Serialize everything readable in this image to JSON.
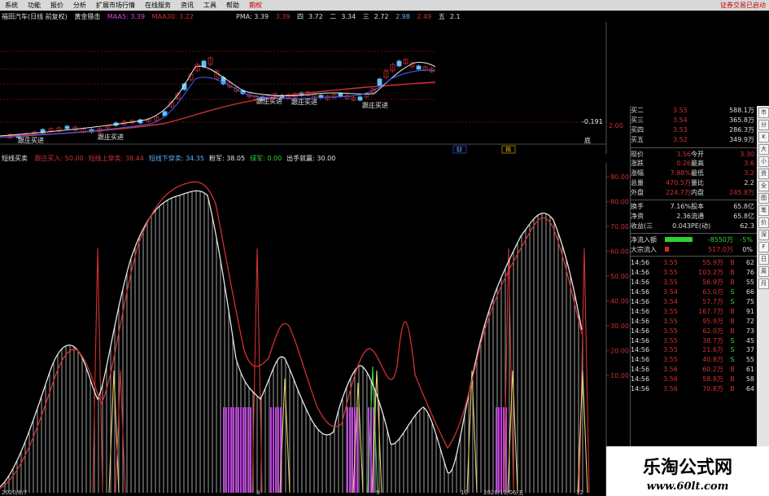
{
  "menubar": {
    "items": [
      "系统",
      "功能",
      "报价",
      "分析",
      "扩展市场行情",
      "在线服务",
      "资讯",
      "工具",
      "帮助",
      "期权"
    ],
    "right_text": "证券交易已启动"
  },
  "upper_info": {
    "stock_title": "福田汽车(日线 前复权)",
    "indicator_name": "黄金猎击",
    "ma5_label": "MAA5: 3.39",
    "ma5_value": "3.39",
    "ma30_label": "MAA30: 3.22",
    "pma_label": "PMA: 3.39",
    "pma_value": "3.39",
    "col2": "3.72",
    "col2_prefix": "四",
    "col3": "3.34",
    "col3_prefix": "二",
    "col4": "2.72",
    "col4_prefix": "三",
    "col5": "2.98",
    "col6": "2.49",
    "col7": "2.1",
    "col7_prefix": "五"
  },
  "upper_chart": {
    "labels": {
      "zhuangbuy1": "跟庄买进",
      "zhuangbuy2": "跟庄买进",
      "zhuangbuy3": "跟庄买进",
      "zhuangbuy4": "跟庄买进",
      "zhuangbuy5": "跟庄买进",
      "zhuangbuy6": "跟庄买进"
    },
    "right_price_top": "2.00",
    "right_price_bottom": "-0.191",
    "bottom_marker": "底",
    "cai": "财",
    "jia": "揭"
  },
  "lower_info": {
    "indicator_name": "短线买卖",
    "items": [
      {
        "text": "跟庄买入: 50.00",
        "color": "#d23030"
      },
      {
        "text": "短线上穿卖: 38.44",
        "color": "#d23030"
      },
      {
        "text": "短线下穿卖: 34.35",
        "color": "#5fb0ff"
      },
      {
        "text": "粉军: 38.05",
        "color": "#e8e8e8"
      },
      {
        "text": "绿军: 0.00",
        "color": "#37d137"
      },
      {
        "text": "出手就赢: 30.00",
        "color": "#e8e8e8"
      }
    ]
  },
  "lower_axis": [
    "90.00",
    "80.00",
    "70.00",
    "60.00",
    "50.00",
    "40.00",
    "30.00",
    "20.00",
    "10.00"
  ],
  "date_axis": [
    "2020/6/7",
    "8",
    "9",
    "10",
    "11",
    "2020/11/06/五",
    "12"
  ],
  "right_panel": {
    "order_book": [
      {
        "label": "买二",
        "price": "3.55",
        "vol": "588.1万"
      },
      {
        "label": "买三",
        "price": "3.54",
        "vol": "365.8万"
      },
      {
        "label": "买四",
        "price": "3.53",
        "vol": "286.3万"
      },
      {
        "label": "买五",
        "price": "3.52",
        "vol": "349.9万"
      }
    ],
    "stats": [
      {
        "l1": "现价",
        "v1": "3.56",
        "l2": "今开",
        "v2": "3.30"
      },
      {
        "l1": "涨跌",
        "v1": "0.26",
        "l2": "最高",
        "v2": "3.6"
      },
      {
        "l1": "涨幅",
        "v1": "7.88%",
        "l2": "最低",
        "v2": "3.2"
      },
      {
        "l1": "总量",
        "v1": "470.5万",
        "l2": "量比",
        "v2": "2.2"
      },
      {
        "l1": "外盘",
        "v1": "224.7万",
        "l2": "内盘",
        "v2": "245.8万"
      }
    ],
    "stats2": [
      {
        "l1": "换手",
        "v1": "7.16%",
        "l2": "股本",
        "v2": "65.8亿"
      },
      {
        "l1": "净资",
        "v1": "2.36",
        "l2": "流通",
        "v2": "65.8亿"
      },
      {
        "l1": "收益(三)",
        "v1": "0.043",
        "l2": "PE(动)",
        "v2": "62.3"
      }
    ],
    "flow": [
      {
        "label": "净流入额",
        "bar_ratio": 0.85,
        "bar_color": "#2ed12e",
        "value": "-8550万",
        "pct": "-5%"
      },
      {
        "label": "大宗流入",
        "bar_ratio": 0.12,
        "bar_color": "#d22",
        "value": "517.0万",
        "pct": "0%"
      }
    ],
    "ticks": [
      {
        "time": "14:56",
        "price": "3.55",
        "vol": "55.9万",
        "bs": "B",
        "n": "62"
      },
      {
        "time": "14:56",
        "price": "3.55",
        "vol": "103.2万",
        "bs": "B",
        "n": "76"
      },
      {
        "time": "14:56",
        "price": "3.55",
        "vol": "56.9万",
        "bs": "B",
        "n": "55"
      },
      {
        "time": "14:56",
        "price": "3.54",
        "vol": "63.0万",
        "bs": "S",
        "n": "66"
      },
      {
        "time": "14:56",
        "price": "3.54",
        "vol": "57.7万",
        "bs": "S",
        "n": "75"
      },
      {
        "time": "14:56",
        "price": "3.55",
        "vol": "167.7万",
        "bs": "B",
        "n": "91"
      },
      {
        "time": "14:56",
        "price": "3.55",
        "vol": "95.9万",
        "bs": "B",
        "n": "72"
      },
      {
        "time": "14:56",
        "price": "3.55",
        "vol": "62.0万",
        "bs": "B",
        "n": "73"
      },
      {
        "time": "14:56",
        "price": "3.55",
        "vol": "38.7万",
        "bs": "S",
        "n": "45"
      },
      {
        "time": "14:56",
        "price": "3.55",
        "vol": "21.6万",
        "bs": "S",
        "n": "37"
      },
      {
        "time": "14:56",
        "price": "3.55",
        "vol": "40.8万",
        "bs": "S",
        "n": "55"
      },
      {
        "time": "14:56",
        "price": "3.56",
        "vol": "60.2万",
        "bs": "B",
        "n": "61"
      },
      {
        "time": "14:56",
        "price": "3.56",
        "vol": "58.8万",
        "bs": "B",
        "n": "58"
      },
      {
        "time": "14:56",
        "price": "3.56",
        "vol": "70.8万",
        "bs": "B",
        "n": "64"
      }
    ]
  },
  "toolstrip": [
    "市",
    "分",
    "K",
    "大",
    "小",
    "资",
    "全",
    "图",
    "笔",
    "价",
    "深",
    "F",
    "日",
    "周",
    "月"
  ],
  "watermark": {
    "title": "乐淘公式网",
    "url": "www.60lt.com"
  },
  "colors": {
    "red": "#d23030",
    "white": "#e8e8e8",
    "yellow": "#e6d070",
    "green": "#37d137",
    "magenta": "#c040e0",
    "blue": "#5fb0ff"
  }
}
